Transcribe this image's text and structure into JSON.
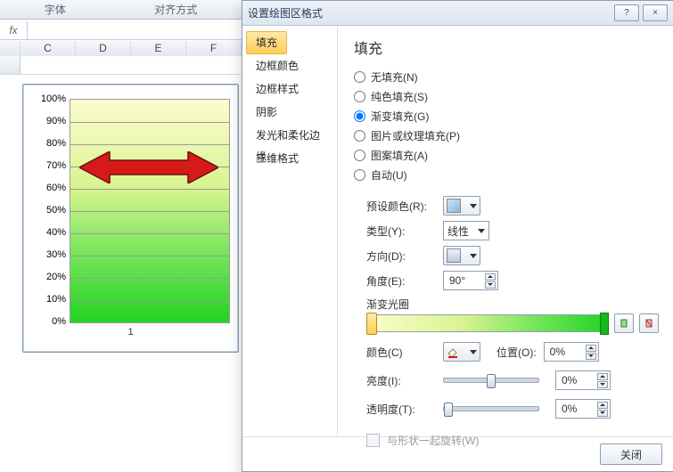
{
  "ribbon": {
    "group_font": "字体",
    "group_align": "对齐方式"
  },
  "formula_bar": {
    "fx": "fx",
    "value": ""
  },
  "columns": [
    "",
    "C",
    "D",
    "E",
    "F"
  ],
  "chart_data": {
    "type": "bar",
    "categories": [
      "1"
    ],
    "values": [
      100
    ],
    "title": "",
    "xlabel": "1",
    "ylabel": "",
    "ylim": [
      0,
      100
    ],
    "yticks": [
      "0%",
      "10%",
      "20%",
      "30%",
      "40%",
      "50%",
      "60%",
      "70%",
      "80%",
      "90%",
      "100%"
    ],
    "fill": "gradient-yellow-green"
  },
  "dialog": {
    "title": "设置绘图区格式",
    "help_icon": "?",
    "close_icon": "×",
    "nav": [
      "填充",
      "边框颜色",
      "边框样式",
      "阴影",
      "发光和柔化边缘",
      "三维格式"
    ],
    "nav_selected": 0,
    "pane": {
      "heading": "填充",
      "fill_options": [
        {
          "label": "无填充(N)",
          "value": "none",
          "checked": false
        },
        {
          "label": "纯色填充(S)",
          "value": "solid",
          "checked": false
        },
        {
          "label": "渐变填充(G)",
          "value": "gradient",
          "checked": true
        },
        {
          "label": "图片或纹理填充(P)",
          "value": "picture",
          "checked": false
        },
        {
          "label": "图案填充(A)",
          "value": "pattern",
          "checked": false
        },
        {
          "label": "自动(U)",
          "value": "auto",
          "checked": false
        }
      ],
      "preset_label": "预设颜色(R):",
      "type_label": "类型(Y):",
      "type_value": "线性",
      "direction_label": "方向(D):",
      "angle_label": "角度(E):",
      "angle_value": "90°",
      "stops_label": "渐变光圈",
      "add_stop_title": "add",
      "remove_stop_title": "remove",
      "color_label": "颜色(C)",
      "position_label": "位置(O):",
      "position_value": "0%",
      "brightness_label": "亮度(I):",
      "brightness_value": "0%",
      "transparency_label": "透明度(T):",
      "transparency_value": "0%",
      "rotate_with_shape": "与形状一起旋转(W)"
    },
    "close_button": "关闭"
  }
}
